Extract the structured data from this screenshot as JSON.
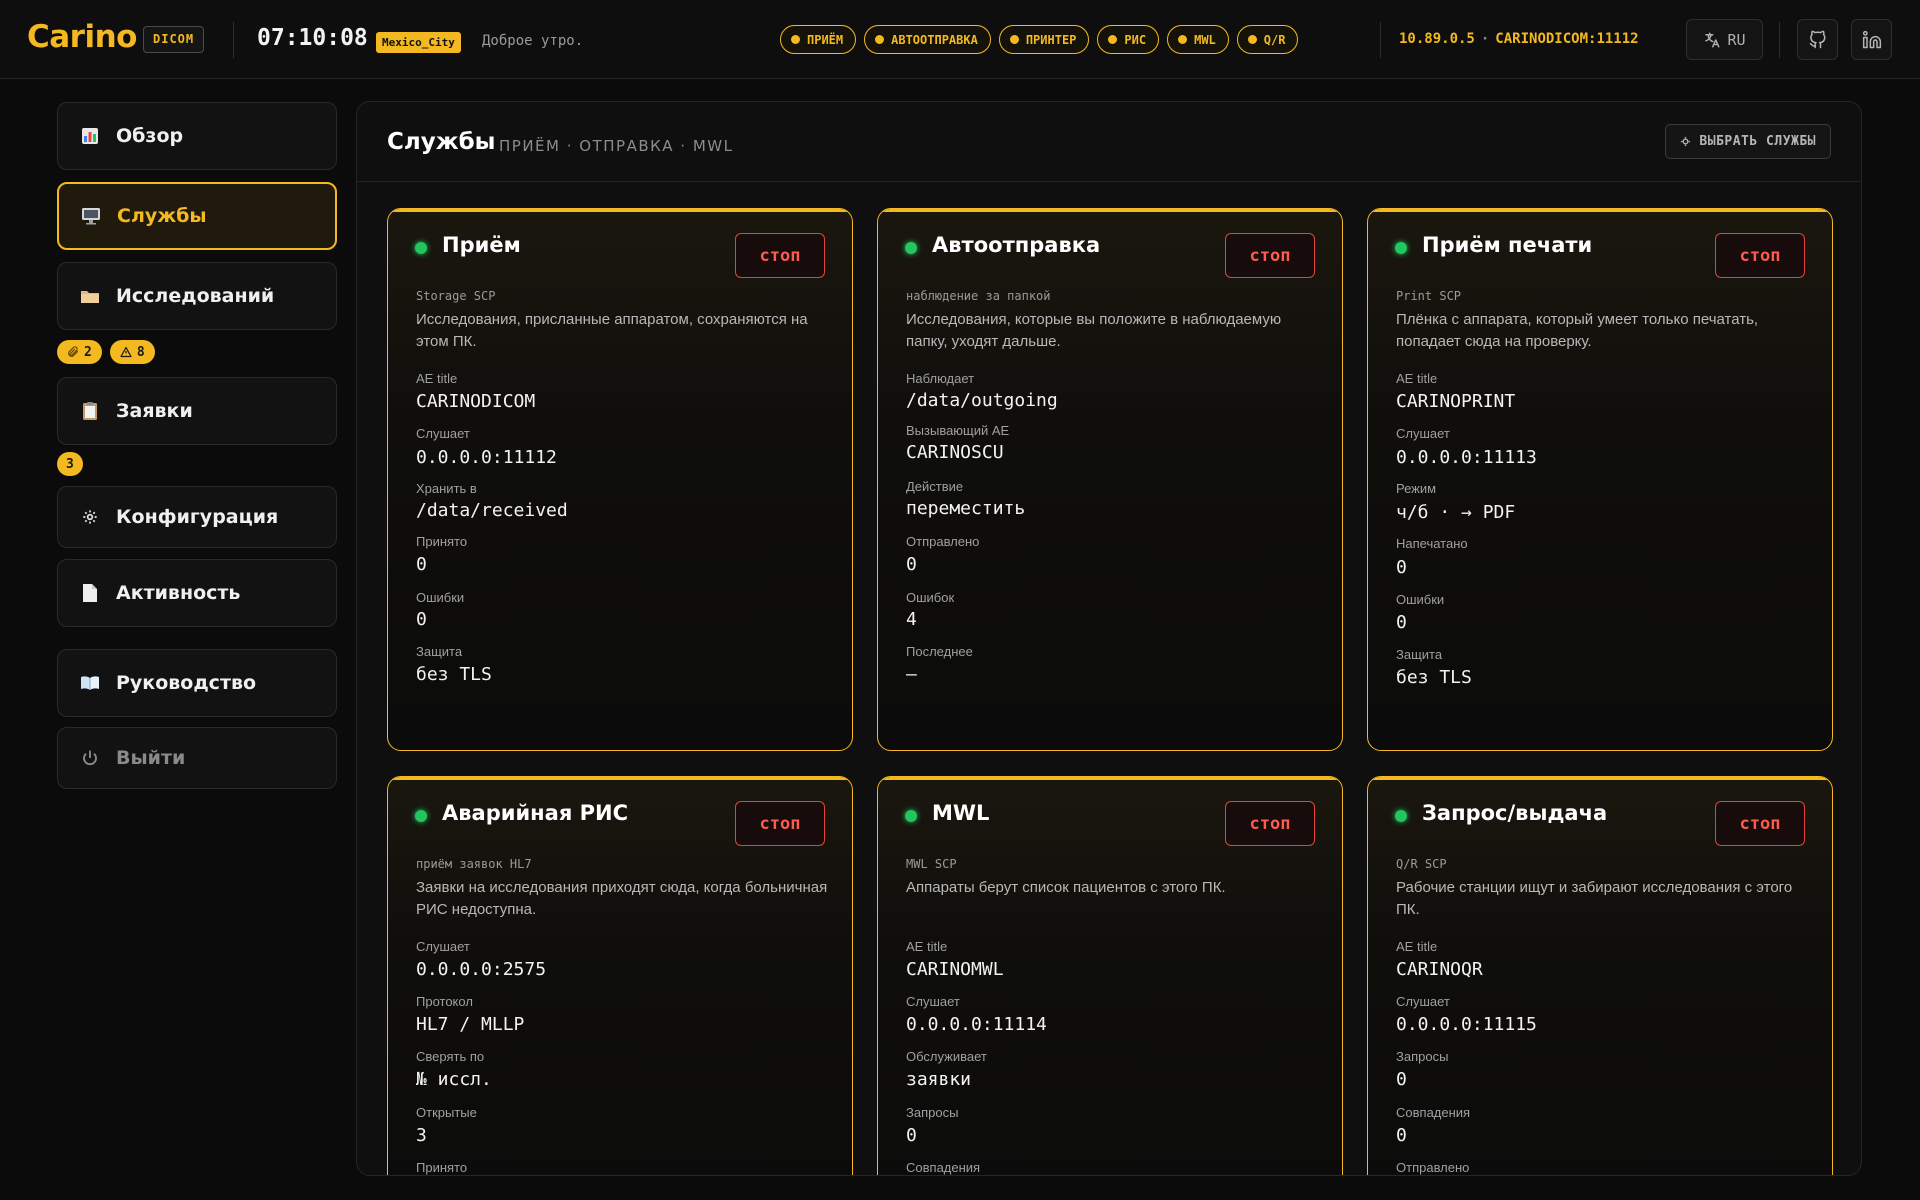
{
  "app": {
    "logo": "Carino",
    "logo_badge": "DICOM",
    "clock": "07:10:08",
    "timezone": "Mexico_City",
    "greeting": "Доброе утро."
  },
  "status_pills": [
    "ПРИЁМ",
    "АВТООТПРАВКА",
    "ПРИНТЕР",
    "РИС",
    "MWL",
    "Q/R"
  ],
  "connection": {
    "ip": "10.89.0.5",
    "separator": "·",
    "aet_port": "CARINODICOM:11112"
  },
  "language": "RU",
  "sidebar": {
    "items": [
      {
        "label": "Обзор",
        "icon": "bar-chart-icon"
      },
      {
        "label": "Службы",
        "icon": "monitor-icon"
      },
      {
        "label": "Исследований",
        "icon": "folder-icon"
      },
      {
        "label": "Заявки",
        "icon": "clipboard-icon"
      },
      {
        "label": "Конфигурация",
        "icon": "gear-icon"
      },
      {
        "label": "Активность",
        "icon": "document-icon"
      },
      {
        "label": "Руководство",
        "icon": "book-icon"
      },
      {
        "label": "Выйти",
        "icon": "power-icon"
      }
    ],
    "studies_badges": [
      {
        "icon": "paperclip-icon",
        "count": "2"
      },
      {
        "icon": "warning-icon",
        "count": "8"
      }
    ],
    "orders_badge": "3"
  },
  "panel": {
    "title": "Службы",
    "subtitle": "ПРИЁМ · ОТПРАВКА · MWL",
    "select_button": "ВЫБРАТЬ СЛУЖБЫ"
  },
  "cards": [
    {
      "title": "Приём",
      "stop": "стоп",
      "tag": "Storage SCP",
      "desc": "Исследования, присланные аппаратом, сохраняются на этом ПК.",
      "fields": [
        {
          "label": "AE title",
          "value": "CARINODICOM"
        },
        {
          "label": "Слушает",
          "value": "0.0.0.0:11112"
        },
        {
          "label": "Хранить в",
          "value": "/data/received"
        },
        {
          "label": "Принято",
          "value": "0"
        },
        {
          "label": "Ошибки",
          "value": "0"
        },
        {
          "label": "Защита",
          "value": "без TLS"
        }
      ]
    },
    {
      "title": "Автоотправка",
      "stop": "стоп",
      "tag": "наблюдение за папкой",
      "desc": "Исследования, которые вы положите в наблюдаемую папку, уходят дальше.",
      "fields": [
        {
          "label": "Наблюдает",
          "value": "/data/outgoing"
        },
        {
          "label": "Вызывающий AE",
          "value": "CARINOSCU"
        },
        {
          "label": "Действие",
          "value": "переместить"
        },
        {
          "label": "Отправлено",
          "value": "0"
        },
        {
          "label": "Ошибок",
          "value": "4"
        },
        {
          "label": "Последнее",
          "value": "—"
        }
      ]
    },
    {
      "title": "Приём печати",
      "stop": "стоп",
      "tag": "Print SCP",
      "desc": "Плёнка с аппарата, который умеет только печатать, попадает сюда на проверку.",
      "fields": [
        {
          "label": "AE title",
          "value": "CARINOPRINT"
        },
        {
          "label": "Слушает",
          "value": "0.0.0.0:11113"
        },
        {
          "label": "Режим",
          "value": "ч/б · → PDF"
        },
        {
          "label": "Напечатано",
          "value": "0"
        },
        {
          "label": "Ошибки",
          "value": "0"
        },
        {
          "label": "Защита",
          "value": "без TLS"
        }
      ]
    },
    {
      "title": "Аварийная РИС",
      "stop": "стоп",
      "tag": "приём заявок HL7",
      "desc": "Заявки на исследования приходят сюда, когда больничная РИС недоступна.",
      "fields": [
        {
          "label": "Слушает",
          "value": "0.0.0.0:2575"
        },
        {
          "label": "Протокол",
          "value": "HL7 / MLLP"
        },
        {
          "label": "Сверять по",
          "value": "№ иссл."
        },
        {
          "label": "Открытые",
          "value": "3"
        },
        {
          "label": "Принято",
          "value": ""
        }
      ]
    },
    {
      "title": "MWL",
      "stop": "стоп",
      "tag": "MWL SCP",
      "desc": "Аппараты берут список пациентов с этого ПК.",
      "fields": [
        {
          "label": "AE title",
          "value": "CARINOMWL"
        },
        {
          "label": "Слушает",
          "value": "0.0.0.0:11114"
        },
        {
          "label": "Обслуживает",
          "value": "заявки"
        },
        {
          "label": "Запросы",
          "value": "0"
        },
        {
          "label": "Совпадения",
          "value": ""
        }
      ]
    },
    {
      "title": "Запрос/выдача",
      "stop": "стоп",
      "tag": "Q/R SCP",
      "desc": "Рабочие станции ищут и забирают исследования с этого ПК.",
      "fields": [
        {
          "label": "AE title",
          "value": "CARINOQR"
        },
        {
          "label": "Слушает",
          "value": "0.0.0.0:11115"
        },
        {
          "label": "Запросы",
          "value": "0"
        },
        {
          "label": "Совпадения",
          "value": "0"
        },
        {
          "label": "Отправлено",
          "value": ""
        }
      ]
    }
  ],
  "colors": {
    "accent": "#f4b920",
    "status_ok": "#22c55e",
    "danger": "#e0443a",
    "background": "#0b0b0b"
  }
}
